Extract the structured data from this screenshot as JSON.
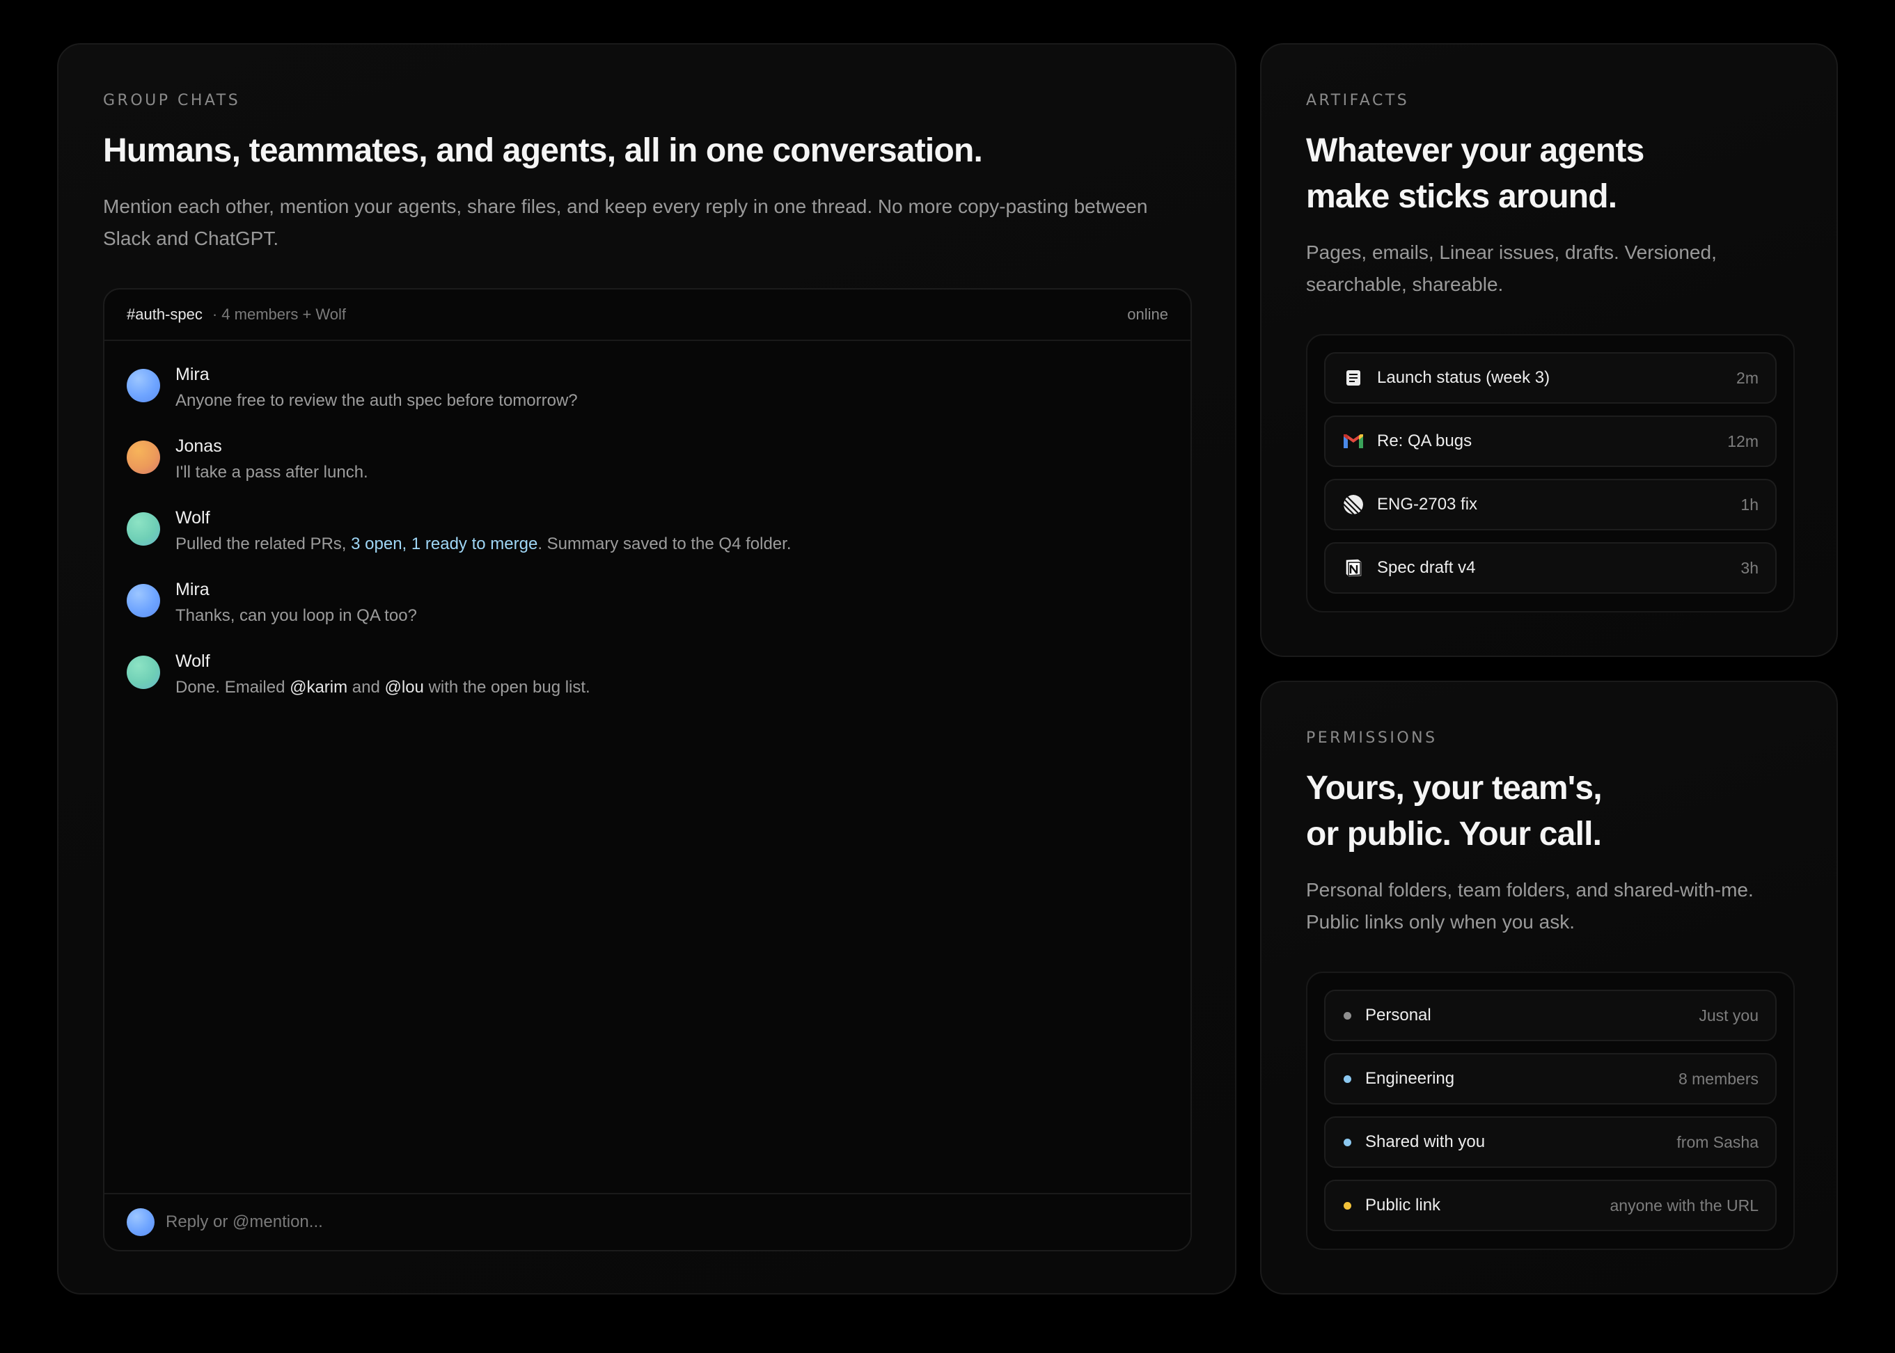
{
  "group_chats": {
    "eyebrow": "GROUP CHATS",
    "headline": "Humans, teammates, and agents, all in one conversation.",
    "lede_line1": "Mention each other, mention your agents, share files, and keep every reply in one thread. No more copy-pasting between",
    "lede_line2": "Slack and ChatGPT.",
    "chat": {
      "channel": "#auth-spec",
      "meta": "· 4 members + Wolf",
      "status": "online",
      "messages": [
        {
          "sender": "Mira",
          "avatar": "blue",
          "text": "Anyone free to review the auth spec before tomorrow?"
        },
        {
          "sender": "Jonas",
          "avatar": "orange",
          "text": "I'll take a pass after lunch."
        },
        {
          "sender": "Wolf",
          "avatar": "green",
          "text_before": "Pulled the related PRs, ",
          "link": "3 open, 1 ready to merge",
          "text_after": ". Summary saved to the Q4 folder."
        },
        {
          "sender": "Mira",
          "avatar": "blue",
          "text": "Thanks, can you loop in QA too?"
        },
        {
          "sender": "Wolf",
          "avatar": "green",
          "text_a": "Done. Emailed ",
          "mention_1": "@karim",
          "text_b": " and ",
          "mention_2": "@lou",
          "text_c": " with the open bug list."
        }
      ],
      "composer_placeholder": "Reply or @mention..."
    }
  },
  "artifacts": {
    "eyebrow": "ARTIFACTS",
    "headline_line1": "Whatever your agents",
    "headline_line2": "make sticks around.",
    "lede_line1": "Pages, emails, Linear issues, drafts. Versioned,",
    "lede_line2": "searchable, shareable.",
    "items": [
      {
        "icon": "document-icon",
        "label": "Launch status (week 3)",
        "time": "2m"
      },
      {
        "icon": "gmail-icon",
        "label": "Re: QA bugs",
        "time": "12m"
      },
      {
        "icon": "linear-icon",
        "label": "ENG-2703 fix",
        "time": "1h"
      },
      {
        "icon": "notion-icon",
        "label": "Spec draft v4",
        "time": "3h"
      }
    ]
  },
  "permissions": {
    "eyebrow": "PERMISSIONS",
    "headline_line1": "Yours, your team's,",
    "headline_line2": "or public. Your call.",
    "lede_line1": "Personal folders, team folders, and shared-with-me.",
    "lede_line2": "Public links only when you ask.",
    "items": [
      {
        "label": "Personal",
        "meta": "Just you",
        "dot_color": "#8f8f8f"
      },
      {
        "label": "Engineering",
        "meta": "8 members",
        "dot_color": "#8cc8f0"
      },
      {
        "label": "Shared with you",
        "meta": "from Sasha",
        "dot_color": "#8cc8f0"
      },
      {
        "label": "Public link",
        "meta": "anyone with the URL",
        "dot_color": "#f2c23a"
      }
    ]
  }
}
